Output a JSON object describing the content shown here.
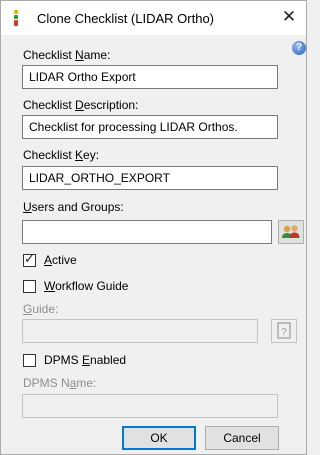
{
  "window": {
    "title": "Clone Checklist  (LIDAR Ortho)",
    "close_glyph": "✕"
  },
  "help": {
    "glyph": "?"
  },
  "form": {
    "name": {
      "label_pre": "Checklist ",
      "label_u": "N",
      "label_post": "ame:",
      "value": "LIDAR Ortho Export"
    },
    "description": {
      "label_pre": "Checklist ",
      "label_u": "D",
      "label_post": "escription:",
      "value": "Checklist for processing LIDAR Orthos."
    },
    "key": {
      "label_pre": "Checklist ",
      "label_u": "K",
      "label_post": "ey:",
      "value": "LIDAR_ORTHO_EXPORT"
    },
    "users": {
      "label_pre": "",
      "label_u": "U",
      "label_post": "sers and Groups:",
      "value": ""
    },
    "active": {
      "label_pre": "",
      "label_u": "A",
      "label_post": "ctive",
      "checked": true
    },
    "workflow_guide": {
      "label_pre": "",
      "label_u": "W",
      "label_post": "orkflow Guide",
      "checked": false
    },
    "guide": {
      "label_pre": "",
      "label_u": "G",
      "label_post": "uide:",
      "value": "",
      "disabled": true
    },
    "dpms_enabled": {
      "label_pre": "DPMS ",
      "label_u": "E",
      "label_post": "nabled",
      "checked": false
    },
    "dpms_name": {
      "label_pre": "DPMS N",
      "label_u": "a",
      "label_post": "me:",
      "value": "",
      "disabled": true
    }
  },
  "buttons": {
    "ok": "OK",
    "cancel": "Cancel"
  },
  "icons": {
    "app": "checklist-app-icon",
    "users_picker": "users-group-icon",
    "guide_picker": "guide-browse-icon"
  },
  "colors": {
    "accent": "#0078d7",
    "dialog_bg": "#f0f0f0",
    "help_blue": "#2a62bf"
  }
}
